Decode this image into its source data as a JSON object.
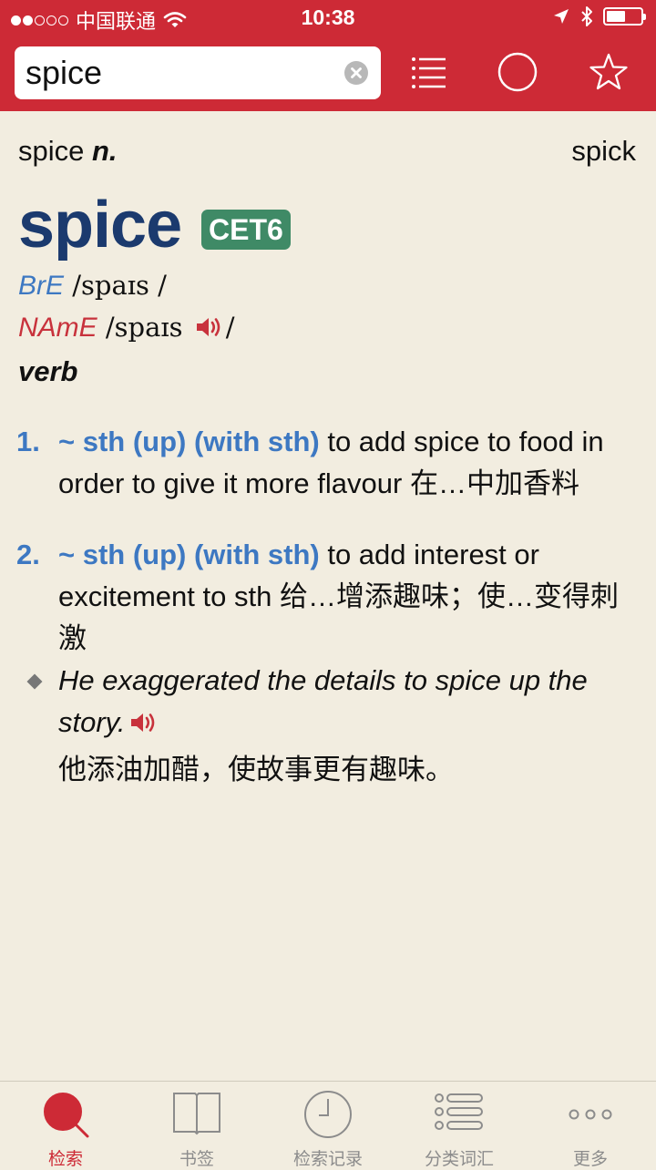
{
  "status_bar": {
    "carrier": "中国联通",
    "time": "10:38",
    "signal_bars_filled": 2,
    "signal_bars_total": 5,
    "battery_level": 0.55
  },
  "search": {
    "value": "spice",
    "placeholder": ""
  },
  "toolbar": {
    "icons": [
      "list-icon",
      "circle-icon",
      "star-icon"
    ]
  },
  "entry": {
    "current_label": "spice",
    "current_pos": "n.",
    "next_word": "spick",
    "headword": "spice",
    "level_badge": "CET6",
    "bre_label": "BrE",
    "bre_ipa": " /spaɪs /",
    "ame_label": "NAmE",
    "ame_ipa": " /spaɪs ",
    "ame_slash": "/",
    "part_of_speech": "verb",
    "senses": [
      {
        "number": "1.",
        "grammar": "~ sth (up) (with sth)",
        "definition": " to add spice to food in order to give it more flavour 在…中加香料"
      },
      {
        "number": "2.",
        "grammar": "~ sth (up) (with sth)",
        "definition": " to add interest or excitement to sth 给…增添趣味；使…变得刺激",
        "example_en": "He exaggerated the details to spice up the story.",
        "example_zh": "他添油加醋，使故事更有趣味。"
      }
    ]
  },
  "tabs": [
    {
      "label": "检索",
      "icon": "search-icon",
      "active": true
    },
    {
      "label": "书签",
      "icon": "book-icon",
      "active": false
    },
    {
      "label": "检索记录",
      "icon": "clock-icon",
      "active": false
    },
    {
      "label": "分类词汇",
      "icon": "list-icon",
      "active": false
    },
    {
      "label": "更多",
      "icon": "more-icon",
      "active": false
    }
  ],
  "colors": {
    "brand_red": "#cd2a36",
    "background": "#f2ede0",
    "headword_blue": "#1b3a6e",
    "link_blue": "#3d78c2",
    "badge_green": "#3f8a66"
  }
}
